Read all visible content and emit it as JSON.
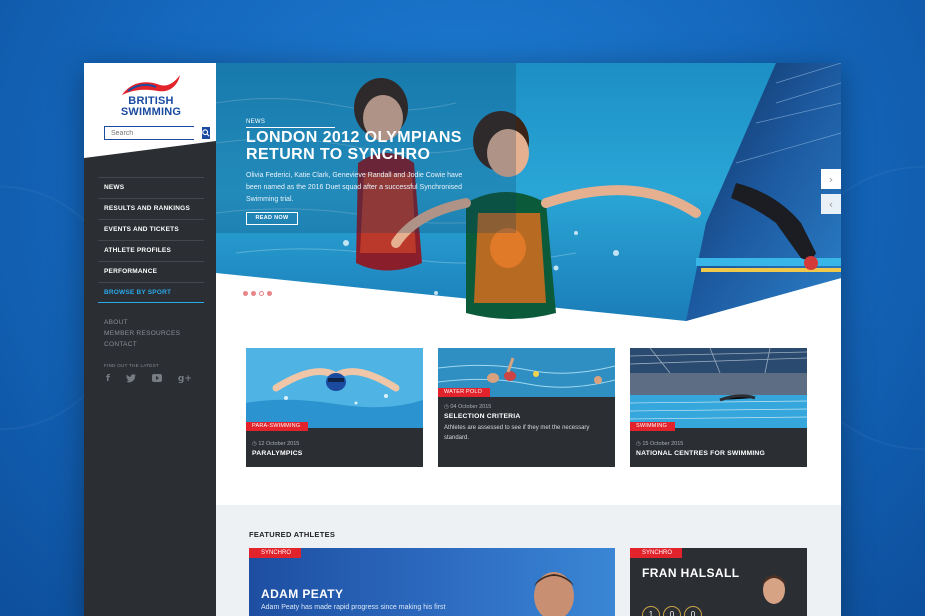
{
  "brand": {
    "logo_line1": "BRITISH",
    "logo_line2": "SWIMMING"
  },
  "search": {
    "placeholder": "Search"
  },
  "nav": {
    "items": [
      {
        "label": "NEWS"
      },
      {
        "label": "RESULTS AND RANKINGS"
      },
      {
        "label": "EVENTS AND TICKETS"
      },
      {
        "label": "ATHLETE PROFILES"
      },
      {
        "label": "PERFORMANCE"
      },
      {
        "label": "BROWSE BY SPORT"
      }
    ],
    "secondary": [
      {
        "label": "ABOUT"
      },
      {
        "label": "MEMBER RESOURCES"
      },
      {
        "label": "CONTACT"
      }
    ],
    "find_out_label": "FIND OUT THE LATEST",
    "social": [
      {
        "icon": "facebook-icon",
        "glyph": "f"
      },
      {
        "icon": "twitter-icon",
        "glyph": "🐦"
      },
      {
        "icon": "youtube-icon",
        "glyph": "▶"
      },
      {
        "icon": "googleplus-icon",
        "glyph": "g+"
      }
    ]
  },
  "hero": {
    "kicker": "NEWS",
    "title": "LONDON 2012 OLYMPIANS RETURN TO SYNCHRO",
    "description": "Olivia Federici, Katie Clark, Genevieve Randall and Jodie Cowie have been named as the 2016 Duet squad after a successful Synchronised Swimming trial.",
    "cta": "READ NOW",
    "slides": 4,
    "active_slide": 3
  },
  "cards": [
    {
      "tag": "PARA-SWIMMING",
      "date": "12 October 2015",
      "title": "PARALYMPICS",
      "text": ""
    },
    {
      "tag": "WATER POLO",
      "date": "04 October 2015",
      "title": "SELECTION CRITERIA",
      "text": "Athletes are assessed to see if they met the necessary standard."
    },
    {
      "tag": "SWIMMING",
      "date": "15 October 2015",
      "title": "NATIONAL CENTRES FOR SWIMMING",
      "text": ""
    }
  ],
  "featured": {
    "heading": "FEATURED ATHLETES",
    "athletes": [
      {
        "tag": "SYNCHRO",
        "name": "ADAM PEATY",
        "desc": "Adam Peaty has made rapid progress since making his first"
      },
      {
        "tag": "SYNCHRO",
        "name": "FRAN HALSALL",
        "scores": [
          "1",
          "0",
          "0"
        ]
      }
    ]
  },
  "colors": {
    "brand_blue": "#1a4ba0",
    "accent_red": "#e2232b",
    "sidebar": "#2b2e33",
    "active_link": "#2aa8e8"
  }
}
